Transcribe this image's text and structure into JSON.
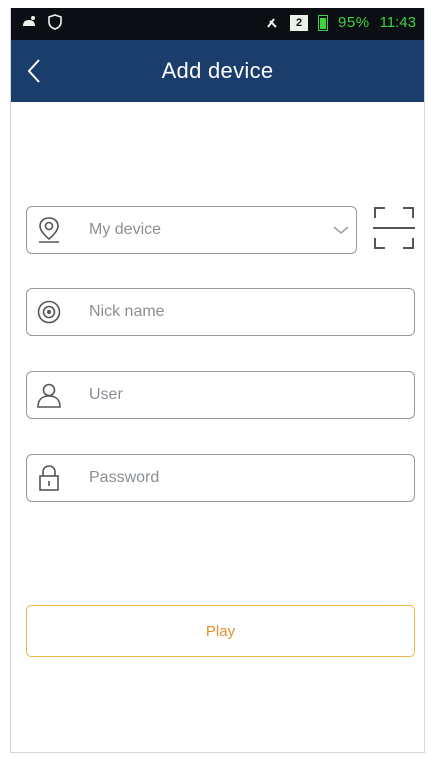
{
  "status_bar": {
    "battery_percent": "95%",
    "time": "11:43",
    "signal_badge": "2",
    "icons": [
      "app-icon",
      "shield-icon",
      "mute-icon",
      "signal-icon",
      "battery-icon"
    ]
  },
  "header": {
    "title": "Add device",
    "back_icon": "back-arrow-icon",
    "background_color": "#1b3d6b"
  },
  "form": {
    "device_select": {
      "value": "My device",
      "icon": "device-location-icon"
    },
    "nick_name": {
      "placeholder": "Nick name",
      "icon": "camera-icon"
    },
    "user": {
      "placeholder": "User",
      "icon": "user-icon"
    },
    "password": {
      "placeholder": "Password",
      "icon": "lock-icon"
    },
    "scan_icon": "qr-scan-icon"
  },
  "play_button": {
    "label": "Play",
    "accent_color": "#f2b64a"
  }
}
